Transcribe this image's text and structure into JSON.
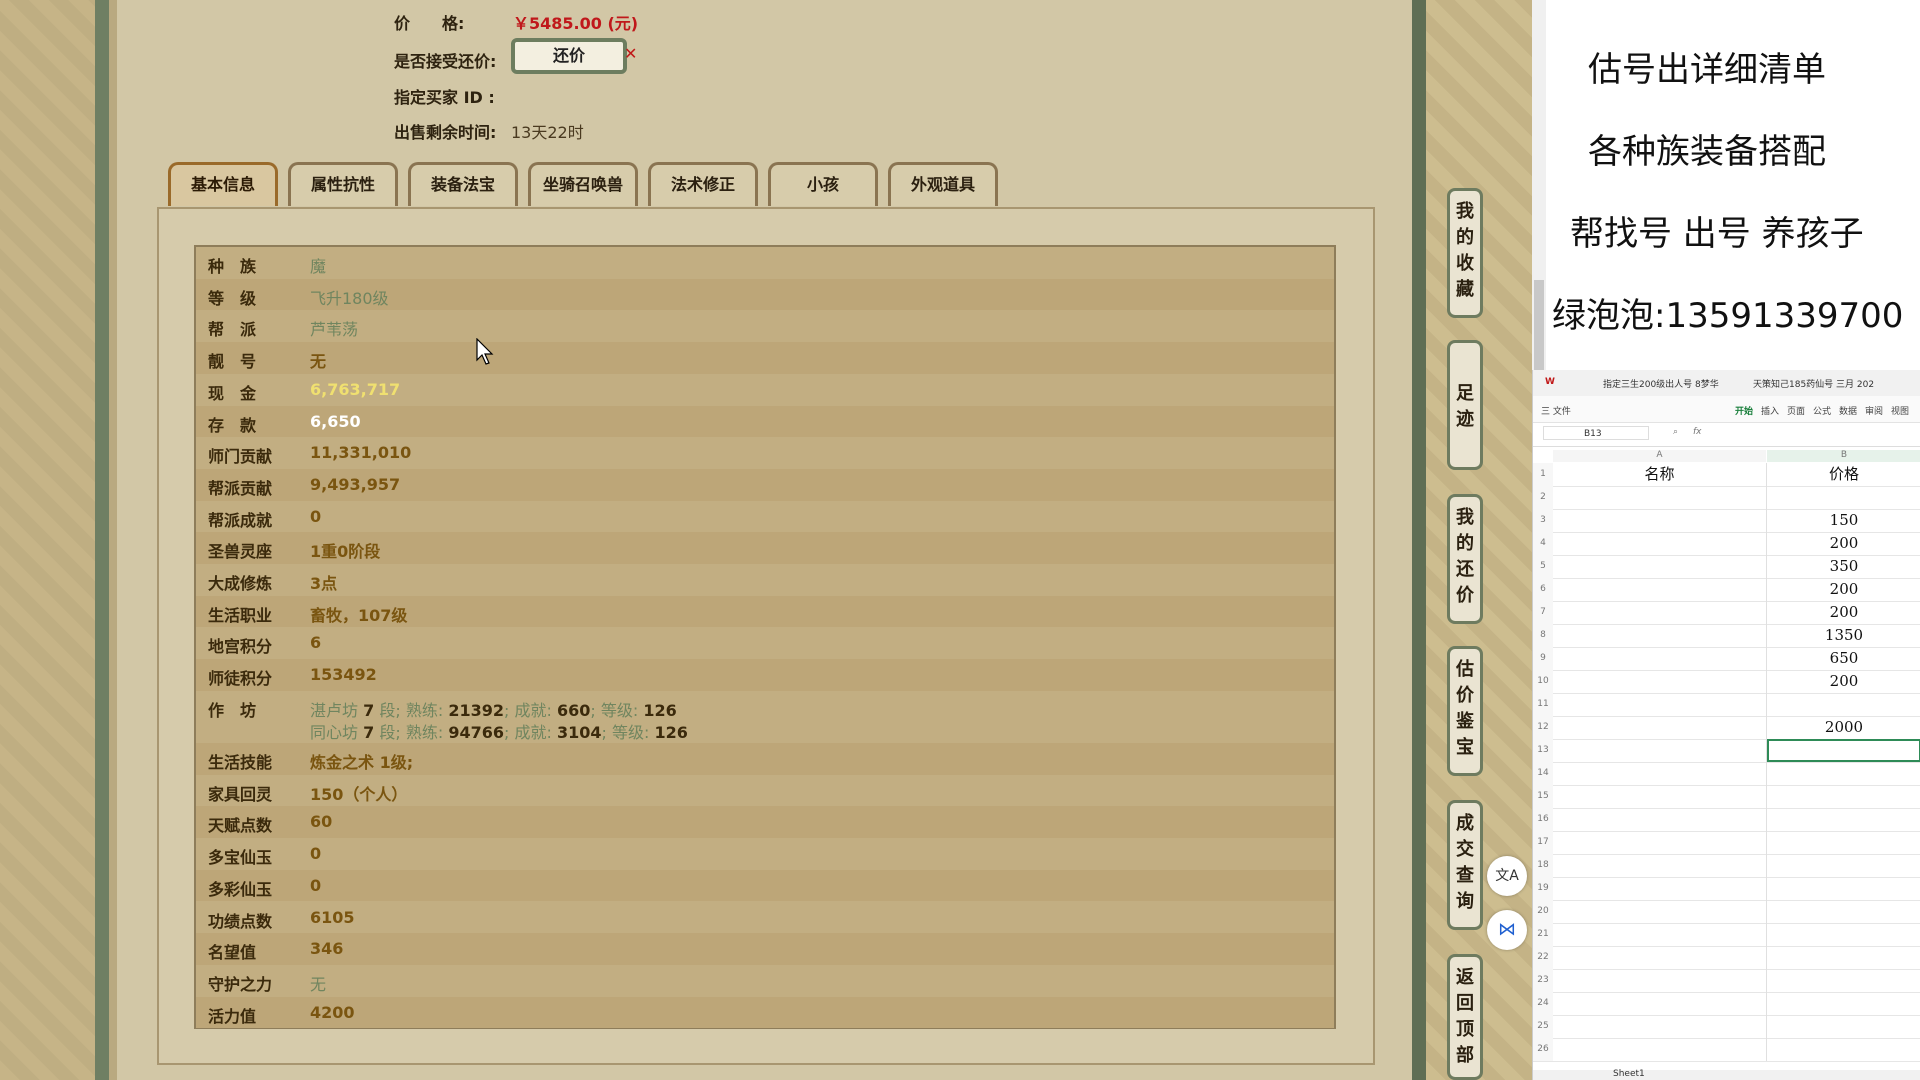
{
  "top_info": {
    "price_label": "价　　格:",
    "price_value": "￥5485.00 (元)",
    "counter_label": "是否接受还价:",
    "counter_button": "还价",
    "counter_x": "✕",
    "buyer_label": "指定买家 ID :",
    "remaining_label": "出售剩余时间:",
    "remaining_value": "13天22时"
  },
  "tabs": [
    "基本信息",
    "属性抗性",
    "装备法宝",
    "坐骑召唤兽",
    "法术修正",
    "小孩",
    "外观道具"
  ],
  "rows": [
    {
      "k": "种　族",
      "v": "魔"
    },
    {
      "k": "等　级",
      "v": "飞升180级"
    },
    {
      "k": "帮　派",
      "v": "芦苇荡"
    },
    {
      "k": "靓　号",
      "v": "无"
    },
    {
      "k": "现　金",
      "v": "6,763,717"
    },
    {
      "k": "存　款",
      "v": "6,650"
    },
    {
      "k": "师门贡献",
      "v": "11,331,010"
    },
    {
      "k": "帮派贡献",
      "v": "9,493,957"
    },
    {
      "k": "帮派成就",
      "v": "0"
    },
    {
      "k": "圣兽灵座",
      "v": "1重0阶段"
    },
    {
      "k": "大成修炼",
      "v": "3点"
    },
    {
      "k": "生活职业",
      "v": "畜牧，107级"
    },
    {
      "k": "地宫积分",
      "v": "6"
    },
    {
      "k": "师徒积分",
      "v": "153492"
    },
    {
      "k": "作　坊",
      "v": ""
    },
    {
      "k": "生活技能",
      "v": "炼金之术 1级;"
    },
    {
      "k": "家具回灵",
      "v": "150（个人）"
    },
    {
      "k": "天赋点数",
      "v": "60"
    },
    {
      "k": "多宝仙玉",
      "v": "0"
    },
    {
      "k": "多彩仙玉",
      "v": "0"
    },
    {
      "k": "功绩点数",
      "v": "6105"
    },
    {
      "k": "名望值",
      "v": "346"
    },
    {
      "k": "守护之力",
      "v": "无"
    },
    {
      "k": "活力值",
      "v": "4200"
    }
  ],
  "workshop": [
    {
      "name": "湛卢坊",
      "seg": "7",
      "seg_unit": "段;",
      "prof_lbl": "熟练:",
      "prof": "21392",
      "ach_lbl": "成就:",
      "ach": "660",
      "lvl_lbl": "等级:",
      "lvl": "126"
    },
    {
      "name": "同心坊",
      "seg": "7",
      "seg_unit": "段;",
      "prof_lbl": "熟练:",
      "prof": "94766",
      "ach_lbl": "成就:",
      "ach": "3104",
      "lvl_lbl": "等级:",
      "lvl": "126"
    }
  ],
  "side_buttons": [
    "我的收藏",
    "足迹",
    "我的还价",
    "估价鉴宝",
    "成交查询",
    "返回顶部"
  ],
  "float_icons": [
    "文A",
    "⋈"
  ],
  "ad_lines": [
    "估号出详细清单",
    "各种族装备搭配",
    "帮找号 出号 养孩子",
    "绿泡泡:13591339700"
  ],
  "spreadsheet": {
    "file_tabs": [
      "W",
      "指定三生200级出人号 8梦华",
      "天策知己185药仙号 三月 202"
    ],
    "menu": [
      "三 文件",
      "开始",
      "插入",
      "页面",
      "公式",
      "数据",
      "审阅",
      "视图"
    ],
    "cell_ref": "B13",
    "fx": "fx",
    "col_a": "A",
    "col_b": "B",
    "header_a": "名称",
    "header_b": "价格",
    "values_b": [
      "",
      "",
      "150",
      "200",
      "350",
      "200",
      "200",
      "1350",
      "650",
      "200",
      "",
      "2000",
      "",
      "",
      "",
      "",
      "",
      "",
      "",
      "",
      "",
      "",
      "",
      "",
      "",
      ""
    ],
    "sheet_name": "Sheet1"
  },
  "colors": {
    "price": "#c0181b",
    "value_brown": "#7a5510",
    "value_green": "#70855f",
    "cash_yellow": "#f0e070"
  }
}
